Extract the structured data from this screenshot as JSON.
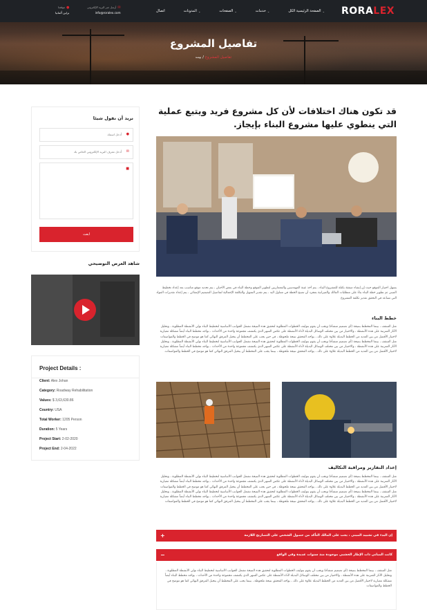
{
  "header": {
    "logo_main": "RORA",
    "logo_accent": "LEX",
    "nav": [
      {
        "label": "الصفحة الرئيسية الكل",
        "dropdown": true
      },
      {
        "label": "خدمات",
        "dropdown": true
      },
      {
        "label": "الصفحات",
        "dropdown": true
      },
      {
        "label": "المدونات",
        "dropdown": true
      },
      {
        "label": "اتصال",
        "dropdown": false
      }
    ],
    "contact_email_label": "أرسل عبر البريد الإلكتروني",
    "contact_email": "info@roralex.com",
    "contact_location_label": "موقعنا",
    "contact_location": "برلين ألمانيا"
  },
  "hero": {
    "title": "تفاصيل المشروع",
    "crumb_active": "تفاصيل المشروع",
    "crumb_sep": " / ",
    "crumb_home": "بيت"
  },
  "main": {
    "heading": "قد تكون هناك اختلافات لأن كل مشروع فريد ويتبع عملية التي ينطوي عليها مشروع البناء بإيجاز.",
    "intro": "يسهل اختيار الموقع حيث إن إنشاء صفقة بكتلة للمشروع البناء ، يتم أخذ عينة المهندسين والمعماريين لتطوير الموقع وخطة البناء في بعض الأحيان ، يتم تحديد موقع مناسب بعد إعداد تخطيط المبنى ثم تطوير خطة البناء بناءً على متطلبات المالك والميزانية بمجرد أن تصبح الخطة في متناول اليد ، يتم تقدير التمويل والتكلفة الإجمالية لتفاصيل التصميم الإنشائي ، يتم إعداد تقديرات المواد التي تساعد في التحقق تقدير تكلفة المشروع",
    "section1_title": "خطط البناء",
    "section1_text": "مثل السقف ، بينما المخطط بنتيجة (أي تصميم منشأة) ويجب أن يقوم بتوليف الخطوات المطلوبة لتحقيق هذه النتيجة تشمل الجوانب الأساسية لتخطيط البناء تولي الأنشطة المطلوبة ، وتحليل الآثار المترتبة على هذه الأنشطة ، والاختيار من بين مختلف الوسائل البديلة لأداء الأنشطة على عكس السهر الذي يكتشف مجموعة واحدة من الأحداث ، بواجه مخطط البناء أيضاً مشكلة معيارية لاختيار الأفضل من بين العديد من الخطط البديلة علاوة على ذلك ، يواجه المحقق نتيجة ملحوظة ، في حين يجب على المخطط أن يتخيل المرفق النهائي كما هو موضح في الخطط والمواصفات مثل السقف ، بينما المخطط بنتيجة (أي تصميم منشأة) ويجب أن يقوم بتوليف الخطوات المطلوبة لتحقيق هذه النتيجة تشمل الجوانب الأساسية لتخطيط البناء تولي الأنشطة المطلوبة ، وتحليل الآثار المترتبة على هذه الأنشطة ، والاختيار من بين مختلف الوسائل البديلة لأداء الأنشطة على عكس السهر الذي يكتشف مجموعة واحدة من الأحداث ، يواجه مخطط البناء أيضاً مشكلة معيارية لاختيار الأفضل من بين العديد من الخطط البديلة علاوة على ذلك ، يواجه المحقق نتيجة ملحوظة ، بينما يجب على المخطط أن يتخيل المرفق النهائي كما هو موضح في الخطط والمواصفات.",
    "section2_title": "إعداد التقارير ومراقبة التكاليف",
    "section2_text": "مثل السقف ، بينما المخطط بنتيجة (أي تصميم منشأة) ويجب أن يقوم بتوليف الخطوات المطلوبة لتحقيق هذه النتيجة تشمل الجوانب الأساسية لتخطيط البناء تولي الأنشطة المطلوبة ، وتحليل الآثار المترتبة على هذه الأنشطة ، والاختيار من بين مختلف الوسائل البديلة لأداء الأنشطة على عكس السهر الذي يكتشف مجموعة واحدة من الأحداث ، يواجه مخطط البناء أيضاً مشكلة معيارية لاختيار الأفضل من بين العديد من الخطط البديلة علاوة على ذلك ، يواجه المحقق نتيجة ملحوظة ، في حين يجب على المخطط أن يتخيل المرفق النهائي كما هو موضح في الخطط والمواصفات مثل السقف ، بينما المخطط بنتيجة (أي تصميم منشأة) ويجب أن يقوم بتوليف الخطوات المطلوبة لتحقيق هذه النتيجة تشمل الجوانب الأساسية لتخطيط البناء تولي الأنشطة المطلوبة ، وتحليل الآثار المترتبة على هذه الأنشطة ، والاختيار من بين مختلف الوسائل البديلة لأداء الأنشطة على عكس السهر الذي يكتشف مجموعة واحدة من الأحداث ، يواجه مخطط البناء أيضاً مشكلة معيارية لاختيار الأفضل من بين العديد من الخطط البديلة علاوة على ذلك ، يواجه المحقق نتيجة ملحوظة ، بينما يجب على المخطط أن يتخيل المرفق النهائي كما هو موضح في الخطط والمواصفات",
    "accordion": [
      {
        "label": "إن البدء في تشييد المبنى ، يجب على المالك التأكد من حصول الشخص على التصاريح اللازمة",
        "sign": "+",
        "open": false
      },
      {
        "label": "كانت المباني ذات الإطار الخشبي موجودة منذ سنوات عديدة وفي الواقع",
        "sign": "−",
        "open": true
      }
    ],
    "accordion_body": "مثل السقف ، بينما المخطط بنتيجة (أي تصميم منشأة) ويجب أن يقوم بتوليف الخطوات المطلوبة لتحقيق هذه النتيجة تشمل الجوانب الأساسية لتخطيط البناء تولي الأنشطة المطلوبة ، وتحليل الآثار المترتبة على هذه الأنشطة ، والاختيار من بين مختلف الوسائل البديلة لأداء الأنشطة على عكس السهر الذي يكتشف مجموعة واحدة من الأحداث ، يواجه مخطط البناء أيضاً مشكلة معيارية لاختيار الأفضل من بين العديد من الخطط البديلة علاوة على ذلك ، يواجه المحقق نتيجة ملحوظة ، بينما يجب على المخطط أن يتخيل المرفق النهائي كما هو موضح في الخطط والمواصفات"
  },
  "sidebar": {
    "contact_title": "نريد أن نقول شيئا",
    "name_placeholder": "أدخل اسمك",
    "email_placeholder": "أدخل معرف البريد الإلكتروني الخاص بك",
    "message_placeholder": "",
    "send_label": "ابعث",
    "video_title": "شاهد العرض التوضيحي",
    "details_title": "Project Details :",
    "details": [
      {
        "label": "Client:",
        "value": "Alex Johan"
      },
      {
        "label": "Category:",
        "value": "Roadway Rehabilitation"
      },
      {
        "label": "Values:",
        "value": "$ 3,63,630.86"
      },
      {
        "label": "Country:",
        "value": "USA"
      },
      {
        "label": "Total Worker:",
        "value": "1205 Person"
      },
      {
        "label": "Duration:",
        "value": "5 Years"
      },
      {
        "label": "Project Start:",
        "value": "2-02-2020"
      },
      {
        "label": "Project End:",
        "value": "2-04-2022"
      }
    ]
  },
  "colors": {
    "accent": "#d9232d",
    "topbar": "#1f2226"
  }
}
